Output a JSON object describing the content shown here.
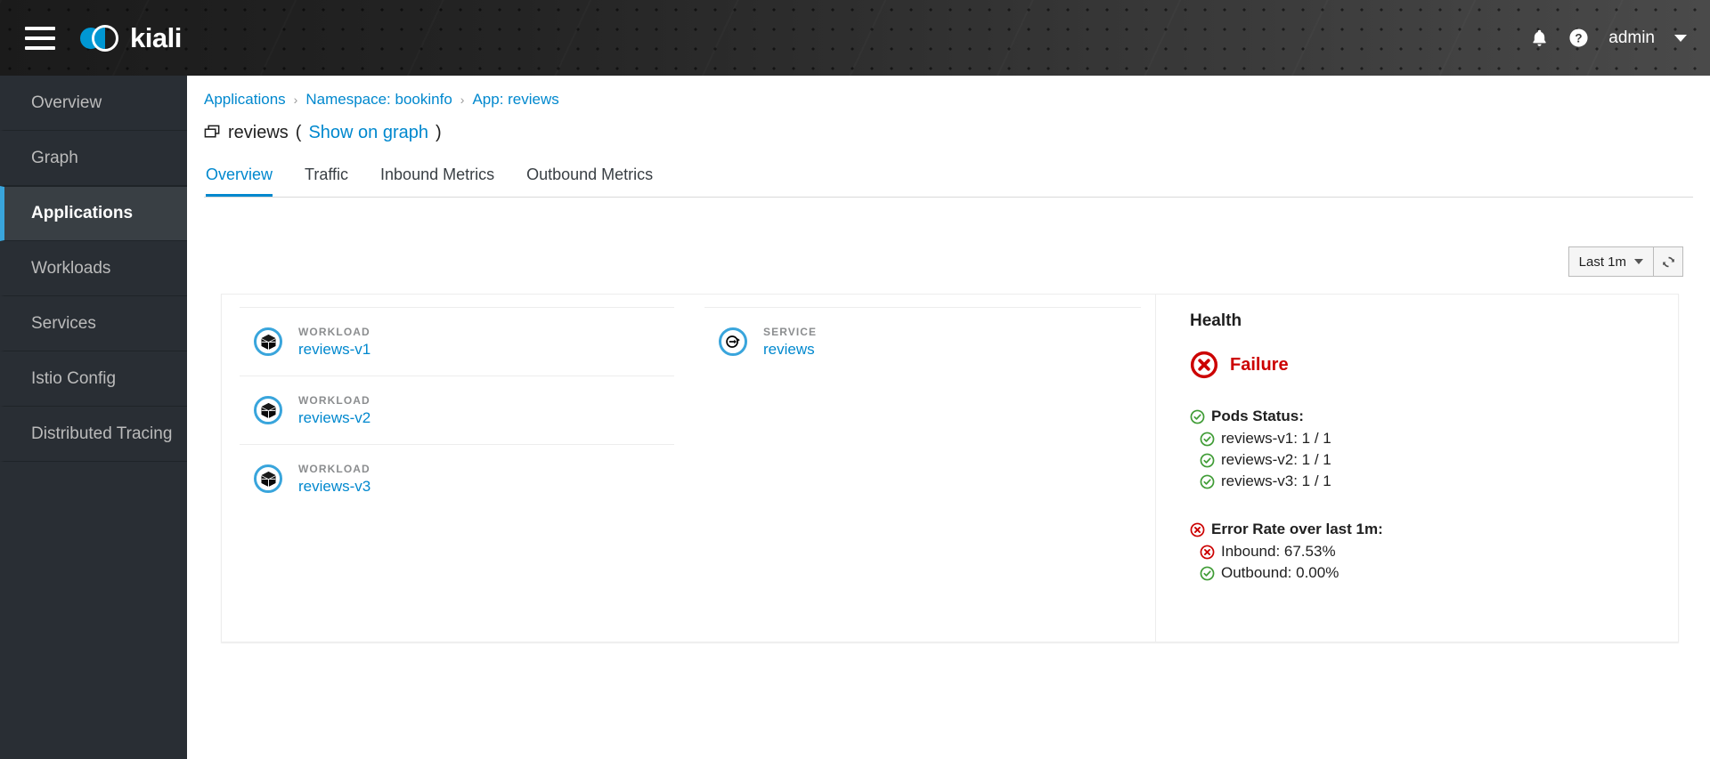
{
  "masthead": {
    "menu_label": "menu-toggle",
    "brand": "kiali",
    "notifications_label": "Notifications",
    "help_label": "Help",
    "user": "admin"
  },
  "sidebar": {
    "items": [
      {
        "label": "Overview",
        "active": false
      },
      {
        "label": "Graph",
        "active": false
      },
      {
        "label": "Applications",
        "active": true
      },
      {
        "label": "Workloads",
        "active": false
      },
      {
        "label": "Services",
        "active": false
      },
      {
        "label": "Istio Config",
        "active": false
      },
      {
        "label": "Distributed Tracing",
        "active": false
      }
    ]
  },
  "breadcrumb": {
    "items": [
      "Applications",
      "Namespace: bookinfo",
      "App: reviews"
    ],
    "separator": "›"
  },
  "page": {
    "title": "reviews",
    "open_paren": "(",
    "show_on_graph": "Show on graph",
    "close_paren": ")"
  },
  "tabs": [
    {
      "label": "Overview",
      "active": true
    },
    {
      "label": "Traffic",
      "active": false
    },
    {
      "label": "Inbound Metrics",
      "active": false
    },
    {
      "label": "Outbound Metrics",
      "active": false
    }
  ],
  "time_controls": {
    "range": "Last 1m",
    "refresh_label": "Refresh"
  },
  "workloads": [
    {
      "kind": "WORKLOAD",
      "name": "reviews-v1"
    },
    {
      "kind": "WORKLOAD",
      "name": "reviews-v2"
    },
    {
      "kind": "WORKLOAD",
      "name": "reviews-v3"
    }
  ],
  "services": [
    {
      "kind": "SERVICE",
      "name": "reviews"
    }
  ],
  "health": {
    "title": "Health",
    "status": "Failure",
    "status_color": "#cc0000",
    "ok_color": "#3f9c35",
    "pods": {
      "heading": "Pods Status:",
      "rows": [
        {
          "text": "reviews-v1: 1 / 1",
          "state": "ok"
        },
        {
          "text": "reviews-v2: 1 / 1",
          "state": "ok"
        },
        {
          "text": "reviews-v3: 1 / 1",
          "state": "ok"
        }
      ]
    },
    "error_rate": {
      "heading": "Error Rate over last 1m:",
      "rows": [
        {
          "text": "Inbound: 67.53%",
          "state": "error"
        },
        {
          "text": "Outbound: 0.00%",
          "state": "ok"
        }
      ]
    }
  }
}
